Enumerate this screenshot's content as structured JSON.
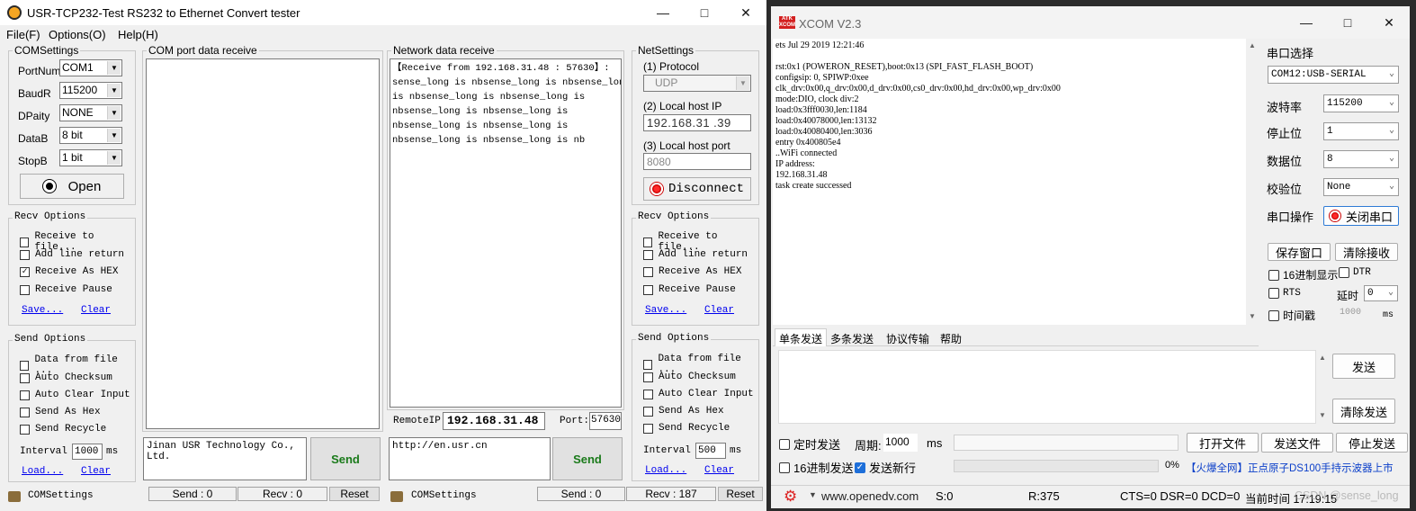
{
  "left": {
    "title": "USR-TCP232-Test  RS232 to Ethernet Convert tester",
    "menu": [
      "File(F)",
      "Options(O)",
      "Help(H)"
    ],
    "com_settings": {
      "legend": "COMSettings",
      "portnum_label": "PortNum",
      "portnum": "COM1",
      "baud_label": "BaudR",
      "baud": "115200",
      "parity_label": "DPaity",
      "parity": "NONE",
      "databits_label": "DataB",
      "databits": "8 bit",
      "stopbits_label": "StopB",
      "stopbits": "1 bit",
      "open_label": "Open"
    },
    "com_recv_opts": {
      "legend": "Recv Options",
      "items": [
        "Receive to file...",
        "Add line return",
        "Receive As HEX",
        "Receive Pause"
      ],
      "checked": [
        false,
        false,
        true,
        false
      ],
      "save": "Save...",
      "clear": "Clear"
    },
    "com_send_opts": {
      "legend": "Send Options",
      "items": [
        "Data from file ...",
        "Auto Checksum",
        "Auto Clear Input",
        "Send As Hex",
        "Send Recycle"
      ],
      "interval_label": "Interval",
      "interval": "1000",
      "unit": "ms",
      "load": "Load...",
      "clear": "Clear"
    },
    "com_receive": {
      "legend": "COM port data receive",
      "content": ""
    },
    "com_send_text": "Jinan USR Technology Co., Ltd.",
    "send_label": "Send",
    "net_receive": {
      "legend": "Network data receive",
      "content": "【Receive from 192.168.31.48 : 57630】:\nsense_long is nbsense_long is nbsense_long\nis nbsense_long is nbsense_long is\nnbsense_long is nbsense_long is\nnbsense_long is nbsense_long is\nnbsense_long is nbsense_long is nb"
    },
    "remote": {
      "ip_label": "RemoteIP:",
      "ip": "192.168.31.48",
      "port_label": "Port:",
      "port": "57630"
    },
    "net_send_text": "http://en.usr.cn",
    "net_settings": {
      "legend": "NetSettings",
      "protocol_label": "(1) Protocol",
      "protocol": "UDP",
      "local_ip_label": "(2) Local host IP",
      "local_ip": "192.168.31 .39",
      "local_port_label": "(3) Local host port",
      "local_port": "8080",
      "disconnect_label": "Disconnect"
    },
    "net_recv_opts": {
      "legend": "Recv Options",
      "items": [
        "Receive to file...",
        "Add line return",
        "Receive As HEX",
        "Receive Pause"
      ],
      "checked": [
        false,
        false,
        false,
        false
      ],
      "save": "Save...",
      "clear": "Clear"
    },
    "net_send_opts": {
      "legend": "Send Options",
      "items": [
        "Data from file ...",
        "Auto Checksum",
        "Auto Clear Input",
        "Send As Hex",
        "Send Recycle"
      ],
      "interval_label": "Interval",
      "interval": "500",
      "unit": "ms",
      "load": "Load...",
      "clear": "Clear"
    },
    "status_left": {
      "label": "COMSettings",
      "send": "Send : 0",
      "recv": "Recv : 0",
      "reset": "Reset"
    },
    "status_right": {
      "label": "COMSettings",
      "send": "Send : 0",
      "recv": "Recv : 187",
      "reset": "Reset"
    }
  },
  "right": {
    "title": "XCOM V2.3",
    "logo": "ATK XCOM",
    "log": "ets Jul 29 2019 12:21:46\n\nrst:0x1 (POWERON_RESET),boot:0x13 (SPI_FAST_FLASH_BOOT)\nconfigsip: 0, SPIWP:0xee\nclk_drv:0x00,q_drv:0x00,d_drv:0x00,cs0_drv:0x00,hd_drv:0x00,wp_drv:0x00\nmode:DIO, clock div:2\nload:0x3fff0030,len:1184\nload:0x40078000,len:13132\nload:0x40080400,len:3036\nentry 0x400805e4\n..WiFi connected\nIP address:\n192.168.31.48\ntask create successed",
    "port_select_label": "串口选择",
    "port_select": "COM12:USB-SERIAL",
    "baud_label": "波特率",
    "baud": "115200",
    "stop_label": "停止位",
    "stop": "1",
    "data_label": "数据位",
    "data": "8",
    "parity_label": "校验位",
    "parity": "None",
    "op_label": "串口操作",
    "close_btn": "关闭串口",
    "save_window": "保存窗口",
    "clear_recv": "清除接收",
    "hex_display": "16进制显示",
    "dtr": "DTR",
    "rts": "RTS",
    "delay_label": "延时",
    "delay": "0",
    "timestamp": "时间戳",
    "timestamp_val": "1000",
    "timestamp_unit": "ms",
    "tabs": [
      "单条发送",
      "多条发送",
      "协议传输",
      "帮助"
    ],
    "send_btn": "发送",
    "clear_send": "清除发送",
    "timed_send": "定时发送",
    "period_label": "周期:",
    "period": "1000",
    "period_unit": "ms",
    "open_file": "打开文件",
    "send_file": "发送文件",
    "stop_send": "停止发送",
    "hex_send": "16进制发送",
    "send_newline": "发送新行",
    "progress": "0%",
    "ad": "【火爆全网】正点原子DS100手持示波器上市",
    "status": {
      "url": "www.openedv.com",
      "s": "S:0",
      "r": "R:375",
      "lines": "CTS=0 DSR=0 DCD=0",
      "time": "当前时间 17:19:15"
    },
    "watermark": "CSDN @sense_long"
  }
}
